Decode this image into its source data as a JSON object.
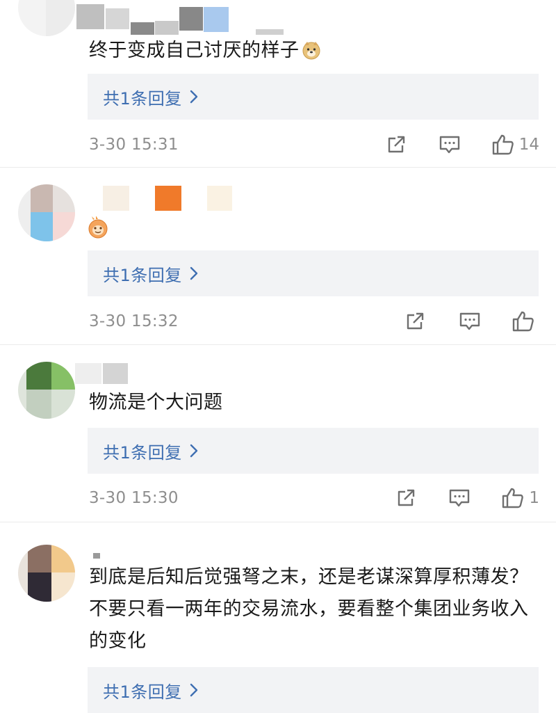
{
  "comments": [
    {
      "text": "终于变成自己讨厌的样子",
      "emoji": "doge-emoji",
      "reply_label": "共1条回复",
      "time": "3-30 15:31",
      "likes": "14"
    },
    {
      "text": "",
      "emoji": "orange-face-emoji",
      "reply_label": "共1条回复",
      "time": "3-30 15:32",
      "likes": ""
    },
    {
      "text": "物流是个大问题",
      "reply_label": "共1条回复",
      "time": "3-30 15:30",
      "likes": "1"
    },
    {
      "text": "到底是后知后觉强弩之末，还是老谋深算厚积薄发？不要只看一两年的交易流水，要看整个集团业务收入的变化",
      "reply_label": "共1条回复"
    }
  ],
  "colors": {
    "reply_link": "#3e6eb1",
    "reply_bg": "#f2f3f5",
    "meta_text": "#8e8e8e",
    "icon_stroke": "#6f6f6f"
  },
  "icons": [
    "share-icon",
    "comment-icon",
    "like-icon",
    "chevron-right-icon"
  ]
}
